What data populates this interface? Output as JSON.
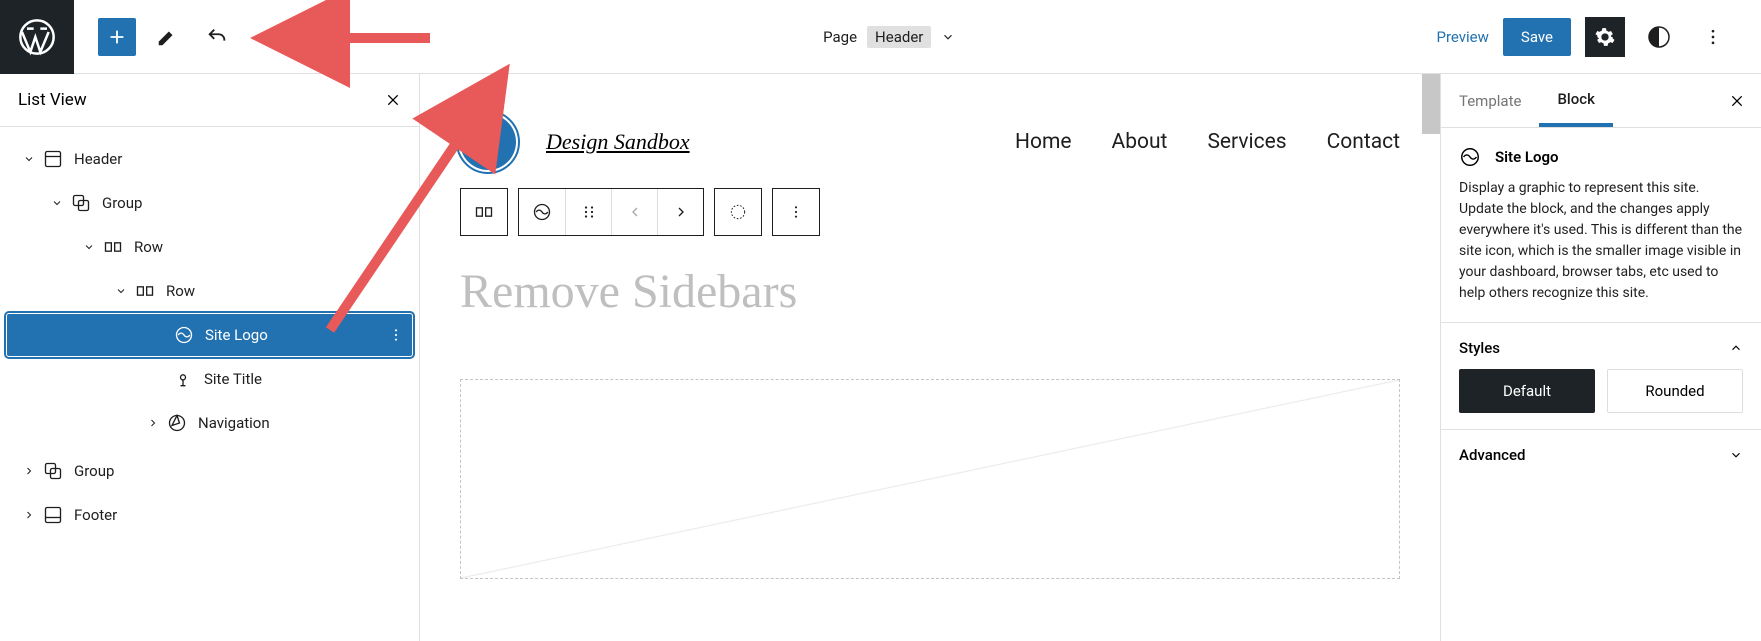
{
  "topbar": {
    "page_label": "Page",
    "template_name": "Header",
    "preview": "Preview",
    "save": "Save"
  },
  "listview": {
    "title": "List View",
    "items": [
      {
        "label": "Header",
        "level": 0,
        "icon": "template-part",
        "expanded": true,
        "chev": true
      },
      {
        "label": "Group",
        "level": 1,
        "icon": "group",
        "expanded": true,
        "chev": true
      },
      {
        "label": "Row",
        "level": 2,
        "icon": "row",
        "expanded": true,
        "chev": true
      },
      {
        "label": "Row",
        "level": 3,
        "icon": "row",
        "expanded": true,
        "chev": true
      },
      {
        "label": "Site Logo",
        "level": 4,
        "icon": "site-logo",
        "selected": true,
        "chev": false
      },
      {
        "label": "Site Title",
        "level": 4,
        "icon": "site-title",
        "chev": false
      },
      {
        "label": "Navigation",
        "level": 3,
        "icon": "navigation",
        "chev": true,
        "collapsed": true
      },
      {
        "label": "Group",
        "level": 0,
        "icon": "group",
        "chev": true,
        "collapsed": true
      },
      {
        "label": "Footer",
        "level": 0,
        "icon": "template-part",
        "chev": true,
        "collapsed": true
      }
    ]
  },
  "canvas": {
    "site_title": "Design Sandbox",
    "nav": [
      "Home",
      "About",
      "Services",
      "Contact"
    ],
    "placeholder_heading": "Remove Sidebars"
  },
  "inspector": {
    "tabs": {
      "template": "Template",
      "block": "Block"
    },
    "block_name": "Site Logo",
    "block_desc": "Display a graphic to represent this site. Update the block, and the changes apply everywhere it's used. This is different than the site icon, which is the smaller image visible in your dashboard, browser tabs, etc used to help others recognize this site.",
    "styles_label": "Styles",
    "style_default": "Default",
    "style_rounded": "Rounded",
    "advanced_label": "Advanced"
  }
}
